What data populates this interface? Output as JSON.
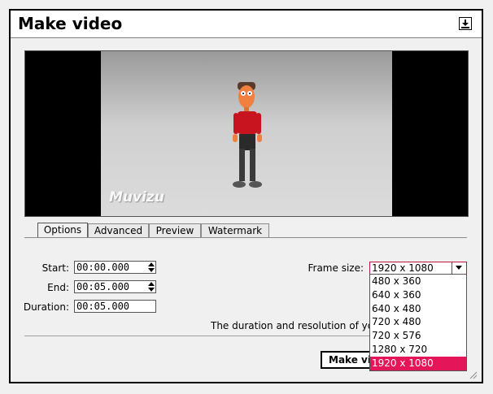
{
  "window": {
    "title": "Make video",
    "pin_icon": "pin-icon"
  },
  "preview": {
    "watermark": "Muvizu"
  },
  "tabs": [
    {
      "label": "Options",
      "active": true
    },
    {
      "label": "Advanced",
      "active": false
    },
    {
      "label": "Preview",
      "active": false
    },
    {
      "label": "Watermark",
      "active": false
    }
  ],
  "fields": {
    "start": {
      "label": "Start:",
      "value": "00:00.000"
    },
    "end": {
      "label": "End:",
      "value": "00:05.000"
    },
    "duration": {
      "label": "Duration:",
      "value": "00:05.000"
    }
  },
  "frame_size": {
    "label": "Frame size:",
    "selected": "1920 x 1080",
    "options": [
      "480 x 360",
      "640 x 360",
      "640 x 480",
      "720 x 480",
      "720 x 576",
      "1280 x 720",
      "1920 x 1080"
    ],
    "highlight_color": "#e5155a"
  },
  "description": "The duration and resolution of you",
  "make_button": "Make video"
}
